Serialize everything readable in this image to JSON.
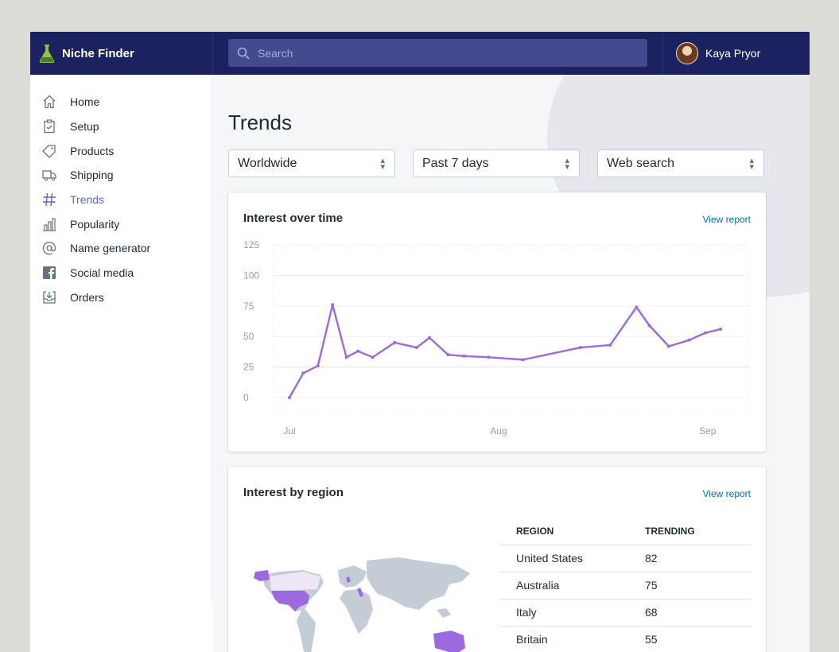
{
  "app": {
    "name": "Niche Finder",
    "logo_icon": "flask-icon",
    "accent": "#5c6ac4",
    "topbar_color": "#1c2160"
  },
  "search": {
    "placeholder": "Search",
    "icon": "search-icon"
  },
  "user": {
    "name": "Kaya Pryor",
    "avatar": "avatar-photo"
  },
  "sidebar": {
    "items": [
      {
        "label": "Home",
        "icon": "home-icon",
        "active": false
      },
      {
        "label": "Setup",
        "icon": "clipboard-icon",
        "active": false
      },
      {
        "label": "Products",
        "icon": "tag-icon",
        "active": false
      },
      {
        "label": "Shipping",
        "icon": "truck-icon",
        "active": false
      },
      {
        "label": "Trends",
        "icon": "hashtag-icon",
        "active": true
      },
      {
        "label": "Popularity",
        "icon": "bar-chart-icon",
        "active": false
      },
      {
        "label": "Name generator",
        "icon": "at-sign-icon",
        "active": false
      },
      {
        "label": "Social media",
        "icon": "facebook-icon",
        "active": false
      },
      {
        "label": "Orders",
        "icon": "inbox-download-icon",
        "active": false
      }
    ]
  },
  "main": {
    "title": "Trends",
    "filters": [
      {
        "value": "Worldwide"
      },
      {
        "value": "Past 7 days"
      },
      {
        "value": "Web search"
      }
    ]
  },
  "interest_over_time": {
    "title": "Interest over time",
    "link": "View report"
  },
  "interest_by_region": {
    "title": "Interest by region",
    "link": "View report",
    "columns": [
      "REGION",
      "TRENDING"
    ],
    "rows": [
      {
        "region": "United States",
        "trending": "82"
      },
      {
        "region": "Australia",
        "trending": "75"
      },
      {
        "region": "Italy",
        "trending": "68"
      },
      {
        "region": "Britain",
        "trending": "55"
      }
    ],
    "highlight_color": "#9c6ade",
    "land_color": "#c4cdd5"
  },
  "chart_data": {
    "type": "line",
    "title": "",
    "xlabel": "",
    "ylabel": "",
    "ylim": [
      0,
      125
    ],
    "yticks": [
      0,
      25,
      50,
      75,
      100,
      125
    ],
    "xtick_labels": [
      "Jul",
      "Aug",
      "Sep"
    ],
    "x": [
      0,
      3.2,
      6.6,
      10,
      13.2,
      15.9,
      19.3,
      24.4,
      29.5,
      32.5,
      36.8,
      40.5,
      46.2,
      54.2,
      67.5,
      74.4,
      80.5,
      83.5,
      88,
      92.7,
      96.5,
      100
    ],
    "x_tick_positions": [
      0,
      48.5,
      97
    ],
    "series": [
      {
        "values": [
          0,
          20,
          26,
          76,
          33,
          38,
          33,
          45,
          41,
          49,
          35,
          34,
          33,
          31,
          41,
          43,
          74,
          59,
          42,
          47,
          53,
          56
        ]
      }
    ],
    "line_color": "#9c6ade",
    "grid": true
  }
}
